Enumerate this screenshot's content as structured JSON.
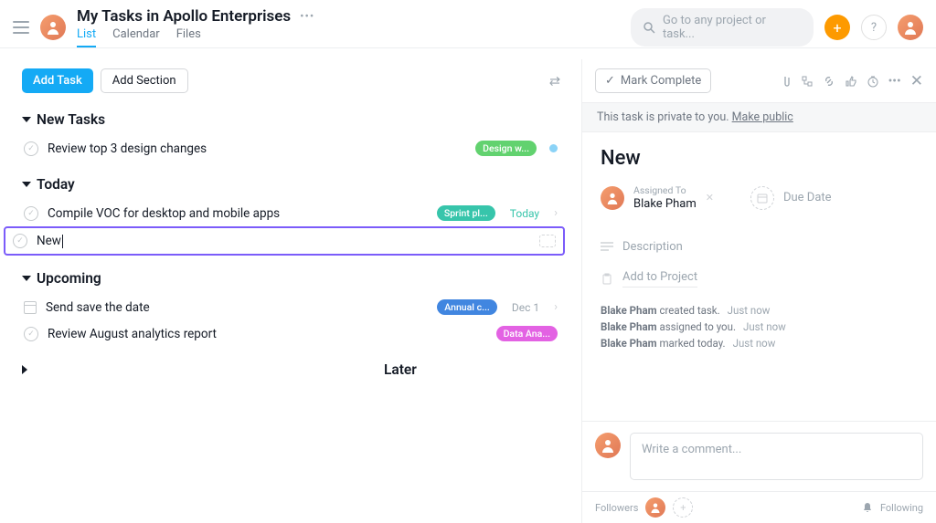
{
  "header": {
    "title": "My Tasks in Apollo Enterprises"
  },
  "tabs": {
    "list": "List",
    "calendar": "Calendar",
    "files": "Files"
  },
  "search": {
    "placeholder": "Go to any project or task..."
  },
  "toolbar": {
    "add_task": "Add Task",
    "add_section": "Add Section"
  },
  "sections": {
    "new_tasks": "New Tasks",
    "today": "Today",
    "upcoming": "Upcoming",
    "later": "Later"
  },
  "tasks": {
    "new0": "Review top 3 design changes",
    "new0_tag": "Design w...",
    "today0": "Compile VOC for desktop and mobile apps",
    "today0_tag": "Sprint pl...",
    "today0_due": "Today",
    "new_typed": "New",
    "up0": "Send save the date",
    "up0_tag": "Annual c...",
    "up0_due": "Dec 1",
    "up1": "Review August analytics report",
    "up1_tag": "Data Ana..."
  },
  "detail": {
    "mark_complete": "Mark Complete",
    "privacy_text": "This task is private to you. ",
    "privacy_link": "Make public",
    "title": "New",
    "assigned_label": "Assigned To",
    "assigned_name": "Blake Pham",
    "due_label": "Due Date",
    "description": "Description",
    "add_project": "Add to Project",
    "log": {
      "l1_a": "Blake Pham",
      "l1_b": " created task.",
      "l1_t": "Just now",
      "l2_a": "Blake Pham",
      "l2_b": " assigned to you.",
      "l2_t": "Just now",
      "l3_a": "Blake Pham",
      "l3_b": " marked today.",
      "l3_t": "Just now"
    },
    "comment_ph": "Write a comment...",
    "followers": "Followers",
    "following": "Following"
  }
}
